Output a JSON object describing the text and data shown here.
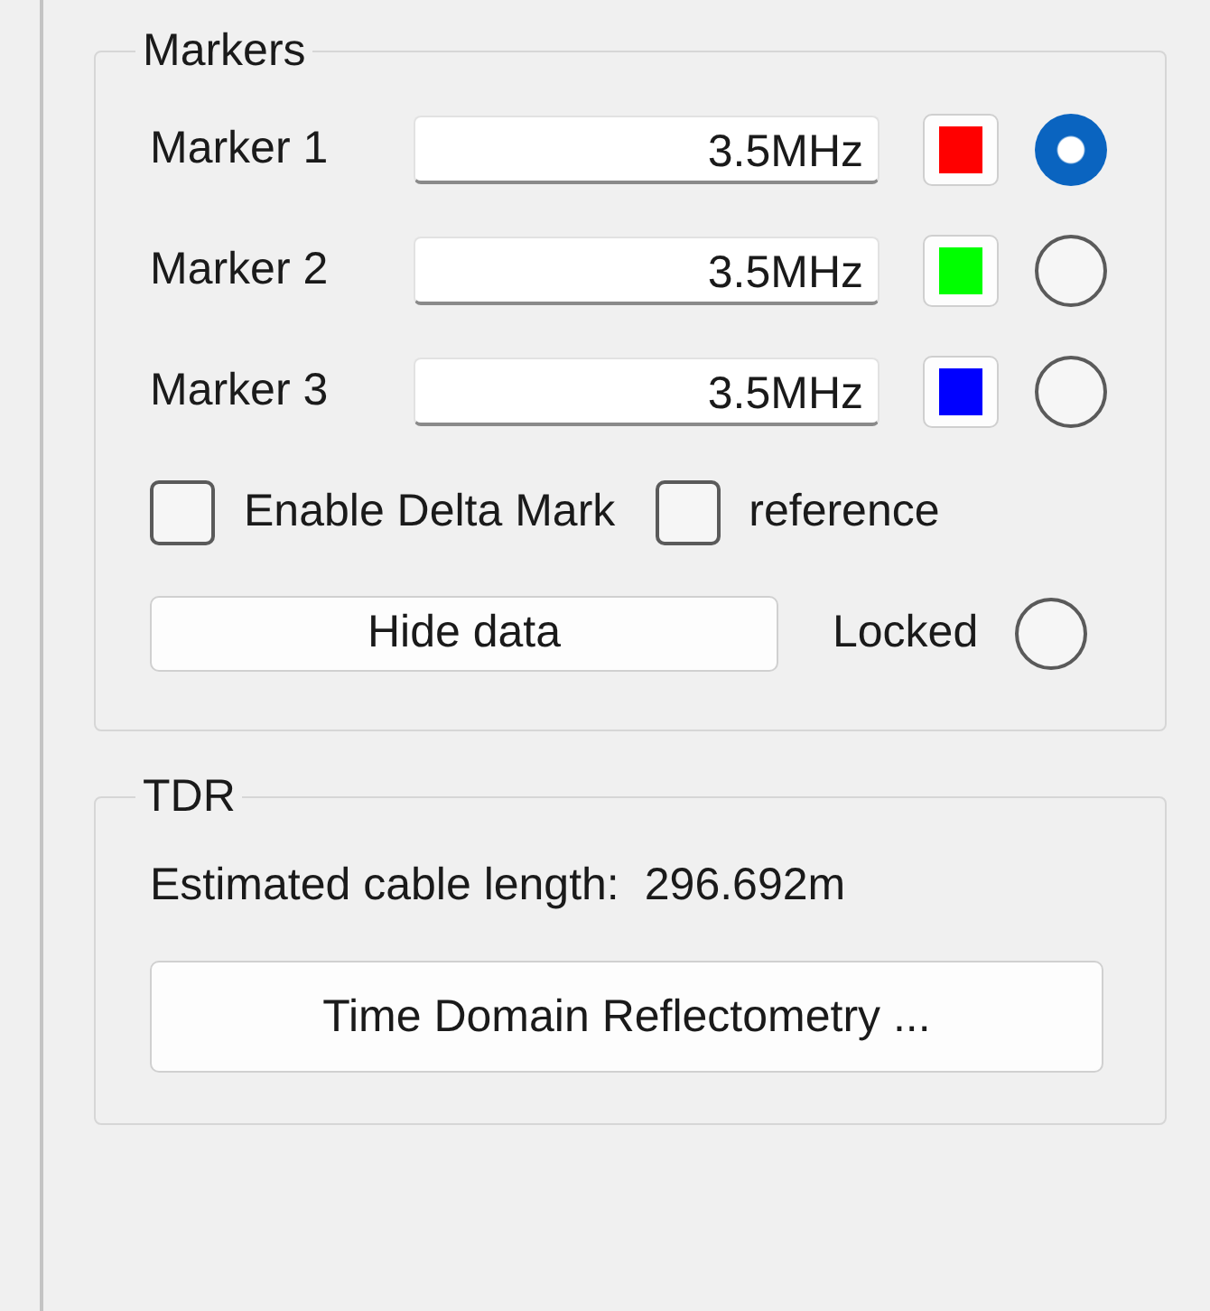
{
  "markers_group": {
    "title": "Markers",
    "markers": [
      {
        "label": "Marker 1",
        "value": "3.5MHz",
        "color": "#ff0000",
        "selected": true
      },
      {
        "label": "Marker 2",
        "value": "3.5MHz",
        "color": "#00ff00",
        "selected": false
      },
      {
        "label": "Marker 3",
        "value": "3.5MHz",
        "color": "#0000ff",
        "selected": false
      }
    ],
    "checkboxes": [
      {
        "label": "Enable Delta Mark",
        "checked": false
      },
      {
        "label": "reference",
        "checked": false
      }
    ],
    "hide_button": "Hide data",
    "locked": {
      "label": "Locked",
      "selected": false
    }
  },
  "tdr_group": {
    "title": "TDR",
    "estimate_label": "Estimated cable length:",
    "estimate_value": "296.692m",
    "button": "Time Domain Reflectometry ..."
  }
}
